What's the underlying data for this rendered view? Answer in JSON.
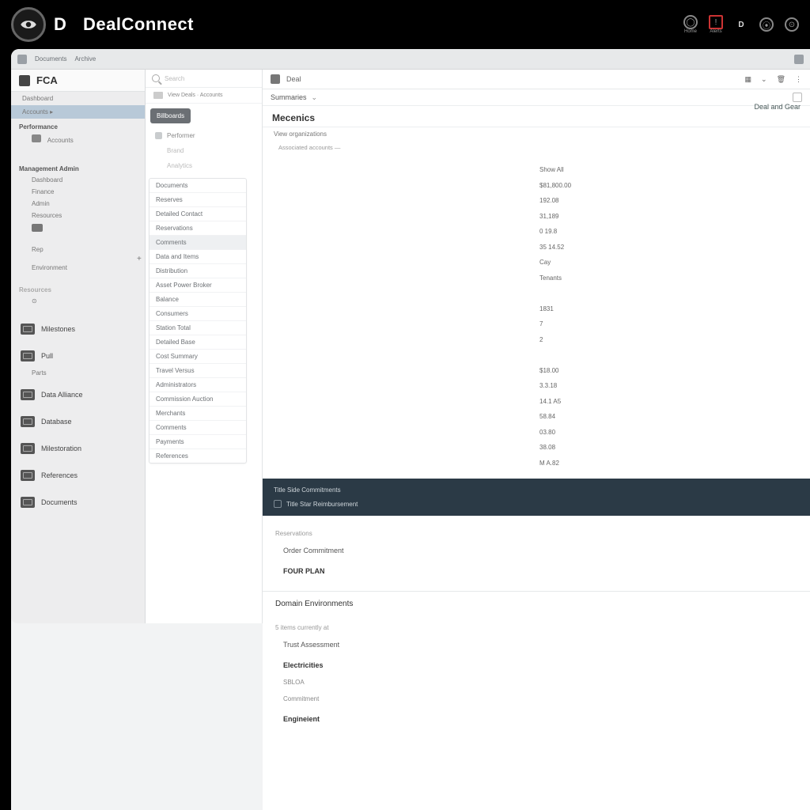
{
  "brand": {
    "letter": "D",
    "name": "DealConnect"
  },
  "header_icons": [
    {
      "label": "User",
      "caption": "Home"
    },
    {
      "label": "Alert",
      "caption": "Alerts"
    },
    {
      "label": "D",
      "caption": ""
    },
    {
      "label": "⦿",
      "caption": ""
    },
    {
      "label": "⊙",
      "caption": ""
    }
  ],
  "toolbar": {
    "crumb1": "Documents",
    "crumb2": "Archive",
    "tab": "Deal"
  },
  "left": {
    "org": "FCA",
    "mini": [
      "Dashboard",
      "Accounts ▸"
    ],
    "subhead1": "Performance",
    "sub_items1": [
      "Accounts"
    ],
    "subhead2": "Management Admin",
    "subs2": [
      "Dashboard",
      "Finance",
      "Admin",
      "Resources"
    ],
    "subhead3": "Rep",
    "subs3": [
      "Environment"
    ],
    "subhead4": "Resources",
    "subs4": [
      "—"
    ],
    "nav": [
      {
        "label": "Milestones"
      },
      {
        "label": "Pull"
      },
      {
        "label": "Data Alliance"
      },
      {
        "label": "Database"
      },
      {
        "label": "Milestoration"
      },
      {
        "label": "References"
      },
      {
        "label": "Documents"
      }
    ],
    "nav_extra": "Parts"
  },
  "sec": {
    "search": "Search",
    "strip": "View Deals · Accounts",
    "chip": "Billboards",
    "items1": [
      "Performer",
      "Brand",
      "Analytics"
    ],
    "group_labels": [
      "Documents",
      "Reserves",
      "Detailed Contact",
      "Reservations",
      "Comments",
      "Data and Items",
      "Distribution",
      "Asset Power Broker",
      "Balance",
      "Consumers",
      "Station Total",
      "Detailed Base",
      "Cost Summary",
      "Travel Versus",
      "Administrators",
      "Commission Auction",
      "Merchants",
      "Comments",
      "Payments",
      "References"
    ]
  },
  "content": {
    "tab": "Deal",
    "dropdown": "Summaries",
    "title": "Mecenics",
    "header_link": "Deal and Gear",
    "meta": "View organizations",
    "meta_sub": "Associated accounts —",
    "values": [
      "Show All",
      "$81,800.00",
      "192.08",
      "31,189",
      "0 19.8",
      "35 14.52",
      "Cay",
      "Tenants",
      "",
      "1831",
      "7",
      "2",
      "",
      "$18.00",
      "3.3.18",
      "14.1 A5",
      "58.84",
      "03.80",
      "38.08",
      "M A.82"
    ],
    "banner_line1": "Title Side Commitments",
    "banner_line2": "Title Star Reimbursement",
    "lower": {
      "label1": "Reservations",
      "item1": "Order Commitment",
      "strong1": "FOUR PLAN",
      "section": "Domain Environments",
      "sub_caption": "5 items currently at",
      "line_a": "Trust Assessment",
      "line_b": "Electricities",
      "line_c": "SBLOA",
      "line_d": "Commitment",
      "line_e": "Engineient"
    }
  }
}
